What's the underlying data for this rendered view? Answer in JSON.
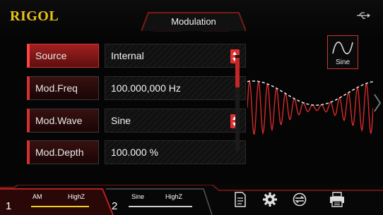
{
  "header": {
    "logo": "RIGOL",
    "title": "Modulation"
  },
  "params": [
    {
      "name": "Source",
      "value": "Internal",
      "dropdown": true,
      "active": true
    },
    {
      "name": "Mod.Freq",
      "value": "100.000,000 Hz",
      "dropdown": false,
      "active": false
    },
    {
      "name": "Mod.Wave",
      "value": "Sine",
      "dropdown": true,
      "active": false
    },
    {
      "name": "Mod.Depth",
      "value": "100.000 %",
      "dropdown": false,
      "active": false
    }
  ],
  "wave_icon": {
    "label": "Sine",
    "icon": "sine-wave-icon"
  },
  "channels": [
    {
      "number": "1",
      "mode": "AM",
      "impedance": "HighZ"
    },
    {
      "number": "2",
      "mode": "Sine",
      "impedance": "HighZ"
    }
  ],
  "toolbar_icons": [
    "document-icon",
    "gear-icon",
    "sync-icon",
    "printer-icon"
  ],
  "colors": {
    "accent": "#d43030",
    "logo": "#e8c21a",
    "channel1_line": "#f0d020"
  }
}
